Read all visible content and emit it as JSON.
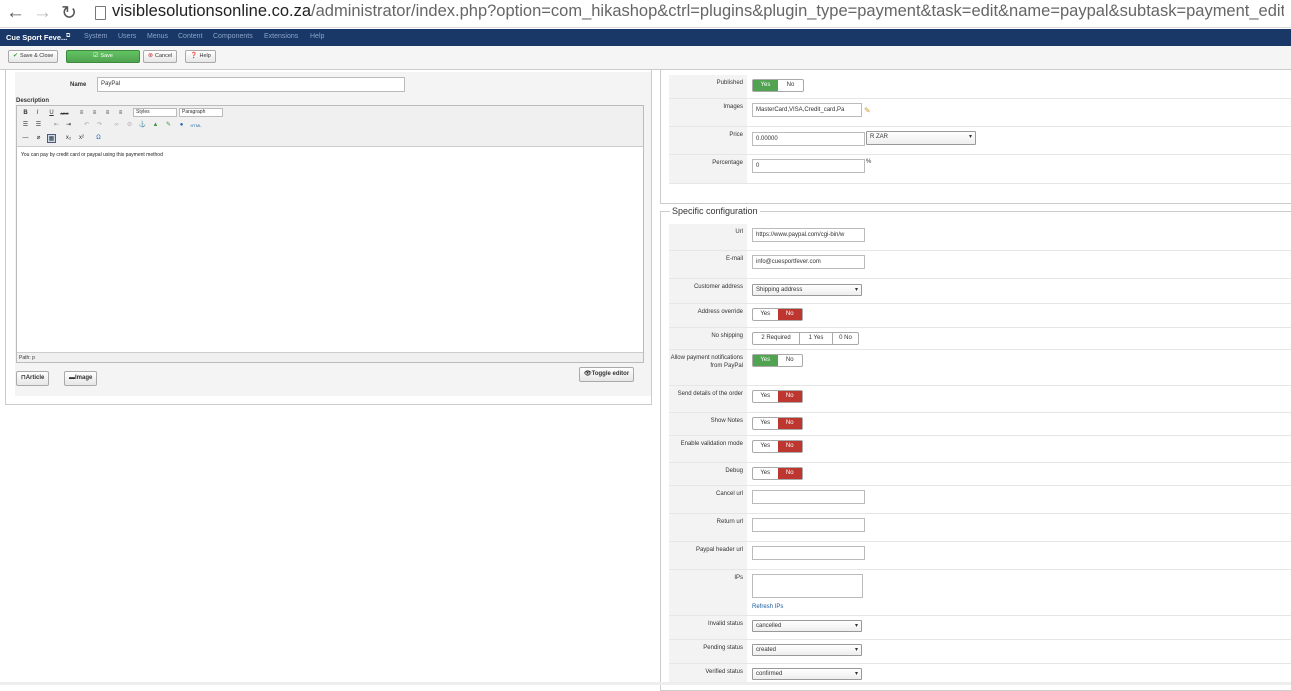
{
  "browser": {
    "url_domain": "visiblesolutionsonline.co.za",
    "url_path": "/administrator/index.php?option=com_hikashop&ctrl=plugins&plugin_type=payment&task=edit&name=paypal&subtask=payment_edit&p"
  },
  "topnav": {
    "brand": "Cue Sport Feve...",
    "menu": [
      "System",
      "Users",
      "Menus",
      "Content",
      "Components",
      "Extensions",
      "Help"
    ]
  },
  "toolbar": {
    "save_close": "Save & Close",
    "save": "Save",
    "cancel": "Cancel",
    "help": "Help"
  },
  "left": {
    "name_label": "Name",
    "name_value": "PayPal",
    "desc_label": "Description",
    "styles": "Styles",
    "paragraph": "Paragraph",
    "body_text": "You can pay by credit card or paypal using this payment method",
    "path": "Path: p",
    "article_btn": "Article",
    "image_btn": "Image",
    "toggle_btn": "Toggle editor"
  },
  "general": {
    "published_label": "Published",
    "images_label": "Images",
    "images_value": "MasterCard,VISA,Credit_card,Pa",
    "price_label": "Price",
    "price_value": "0.00000",
    "currency": "R ZAR",
    "percentage_label": "Percentage",
    "percentage_value": "0",
    "percent_sign": "%"
  },
  "specific": {
    "legend": "Specific configuration",
    "url_label": "Url",
    "url_value": "https://www.paypal.com/cgi-bin/w",
    "email_label": "E-mail",
    "email_value": "info@cuesportfever.com",
    "customer_address_label": "Customer address",
    "customer_address_value": "Shipping address",
    "address_override_label": "Address override",
    "no_shipping_label": "No shipping",
    "no_shipping_opts": [
      "2 Required",
      "1 Yes",
      "0 No"
    ],
    "allow_notif_label": "Allow payment notifications from PayPal",
    "send_details_label": "Send details of the order",
    "show_notes_label": "Show Notes",
    "enable_validation_label": "Enable validation mode",
    "debug_label": "Debug",
    "cancel_url_label": "Cancel url",
    "return_url_label": "Return url",
    "header_url_label": "Paypal header url",
    "ips_label": "IPs",
    "refresh_ips": "Refresh IPs",
    "invalid_status_label": "Invalid status",
    "invalid_status_value": "cancelled",
    "pending_status_label": "Pending status",
    "pending_status_value": "created",
    "verified_status_label": "Verified status",
    "verified_status_value": "confirmed"
  },
  "yesno": {
    "yes": "Yes",
    "no": "No"
  },
  "colors": {
    "nav": "#1a3867",
    "green": "#51a351",
    "red": "#bd362f"
  }
}
